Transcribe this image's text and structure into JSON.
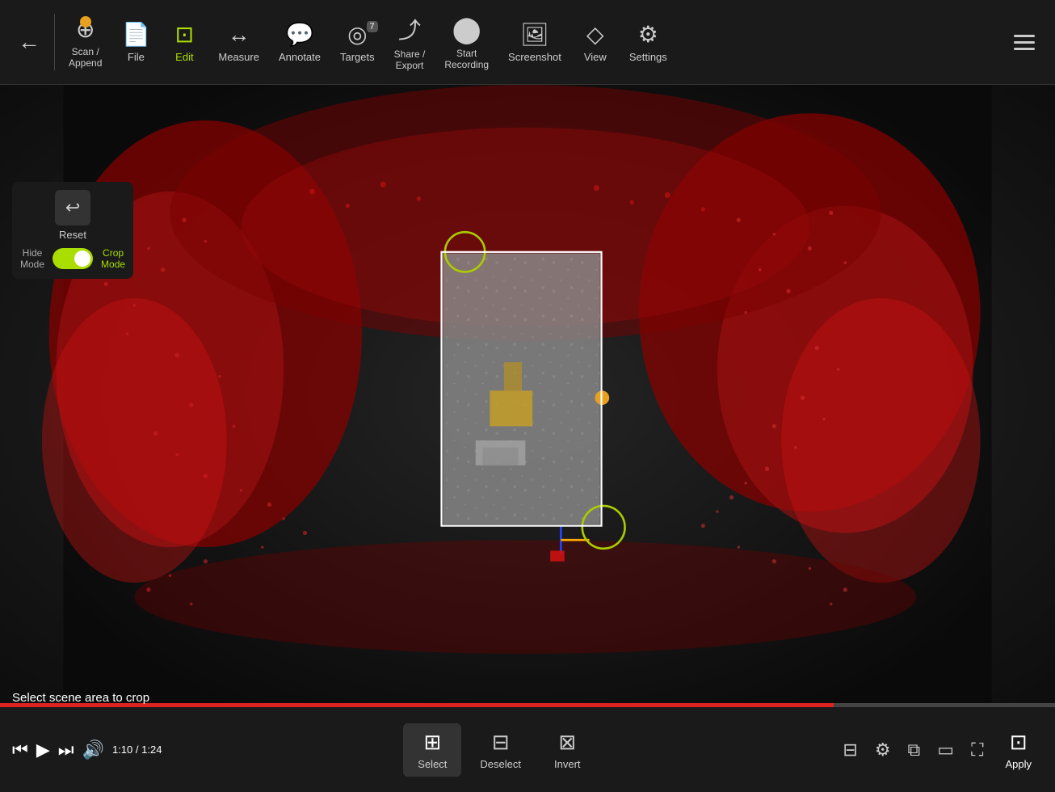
{
  "toolbar": {
    "back_icon": "←",
    "scan_append_label": "Scan /\nAppend",
    "file_label": "File",
    "edit_label": "Edit",
    "measure_label": "Measure",
    "annotate_label": "Annotate",
    "targets_label": "Targets",
    "targets_badge": "7",
    "share_export_label": "Share /\nExport",
    "start_recording_label": "Start\nRecording",
    "screenshot_label": "Screenshot",
    "view_label": "View",
    "settings_label": "Settings"
  },
  "control_panel": {
    "reset_label": "Reset",
    "hide_mode_label": "Hide\nMode",
    "crop_mode_label": "Crop\nMode"
  },
  "viewport": {
    "status_text": "Select scene area to crop"
  },
  "bottom_toolbar": {
    "select_label": "Select",
    "deselect_label": "Deselect",
    "invert_label": "Invert",
    "apply_label": "Apply",
    "time_current": "1:10",
    "time_total": "1:24"
  }
}
